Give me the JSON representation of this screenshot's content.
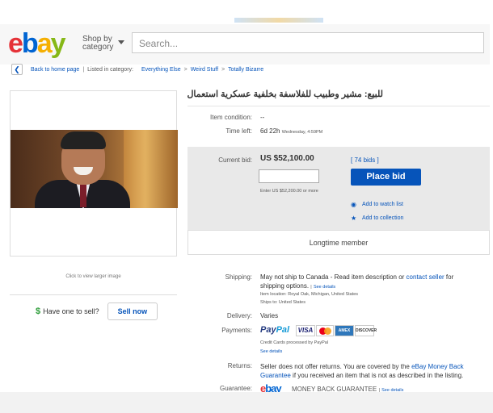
{
  "header": {
    "logo": {
      "e": "e",
      "b": "b",
      "a": "a",
      "y": "y"
    },
    "shop_by": "Shop by",
    "category": "category",
    "search_placeholder": "Search..."
  },
  "breadcrumb": {
    "back_label": "Back to home page",
    "listed_in": "Listed in category:",
    "items": [
      "Everything Else",
      "Weird Stuff",
      "Totally Bizarre"
    ]
  },
  "left": {
    "click_view": "Click to view larger image",
    "have_one": "Have one to sell?",
    "sell_now": "Sell now"
  },
  "item": {
    "title": "للبيع: مشير وطبيب للفلاسفة بخلفية عسكرية استعمال طبيب",
    "condition_label": "Item condition:",
    "condition_value": "--",
    "time_left_label": "Time left:",
    "time_left_value": "6d 22h",
    "time_left_detail": "Wednesday, 4:59PM",
    "current_bid_label": "Current bid:",
    "current_bid_value": "US $52,100.00",
    "bids": "[ 74 bids ]",
    "enter_hint": "Enter US $52,200.00 or more",
    "place_bid": "Place bid",
    "watch_list": "Add to watch list",
    "collection": "Add to collection",
    "member": "Longtime member"
  },
  "shipping": {
    "label": "Shipping:",
    "text1": "May not ship to Canada - Read item description or",
    "contact": "contact seller",
    "text2": "for",
    "text3": "shipping options.",
    "see_details": "See details",
    "location": "Item location:  Royal Oak, Michigan, United States",
    "ships_to": "Ships to:  United States"
  },
  "delivery": {
    "label": "Delivery:",
    "value": "Varies"
  },
  "payments": {
    "label": "Payments:",
    "paypal1": "Pay",
    "paypal2": "Pal",
    "visa": "VISA",
    "amex": "AMEX",
    "discover": "DISCOVER",
    "note": "Credit Cards processed by PayPal",
    "see_details": "See details"
  },
  "returns": {
    "label": "Returns:",
    "text1": "Seller does not offer returns. You are covered by the",
    "link1": "eBay Money Back",
    "link2": "Guarantee",
    "text2": "if you received an item that is not as described in the listing."
  },
  "guarantee": {
    "label": "Guarantee:",
    "e": "e",
    "bay": "bay",
    "text": "MONEY BACK GUARANTEE",
    "see_details": "See details"
  }
}
